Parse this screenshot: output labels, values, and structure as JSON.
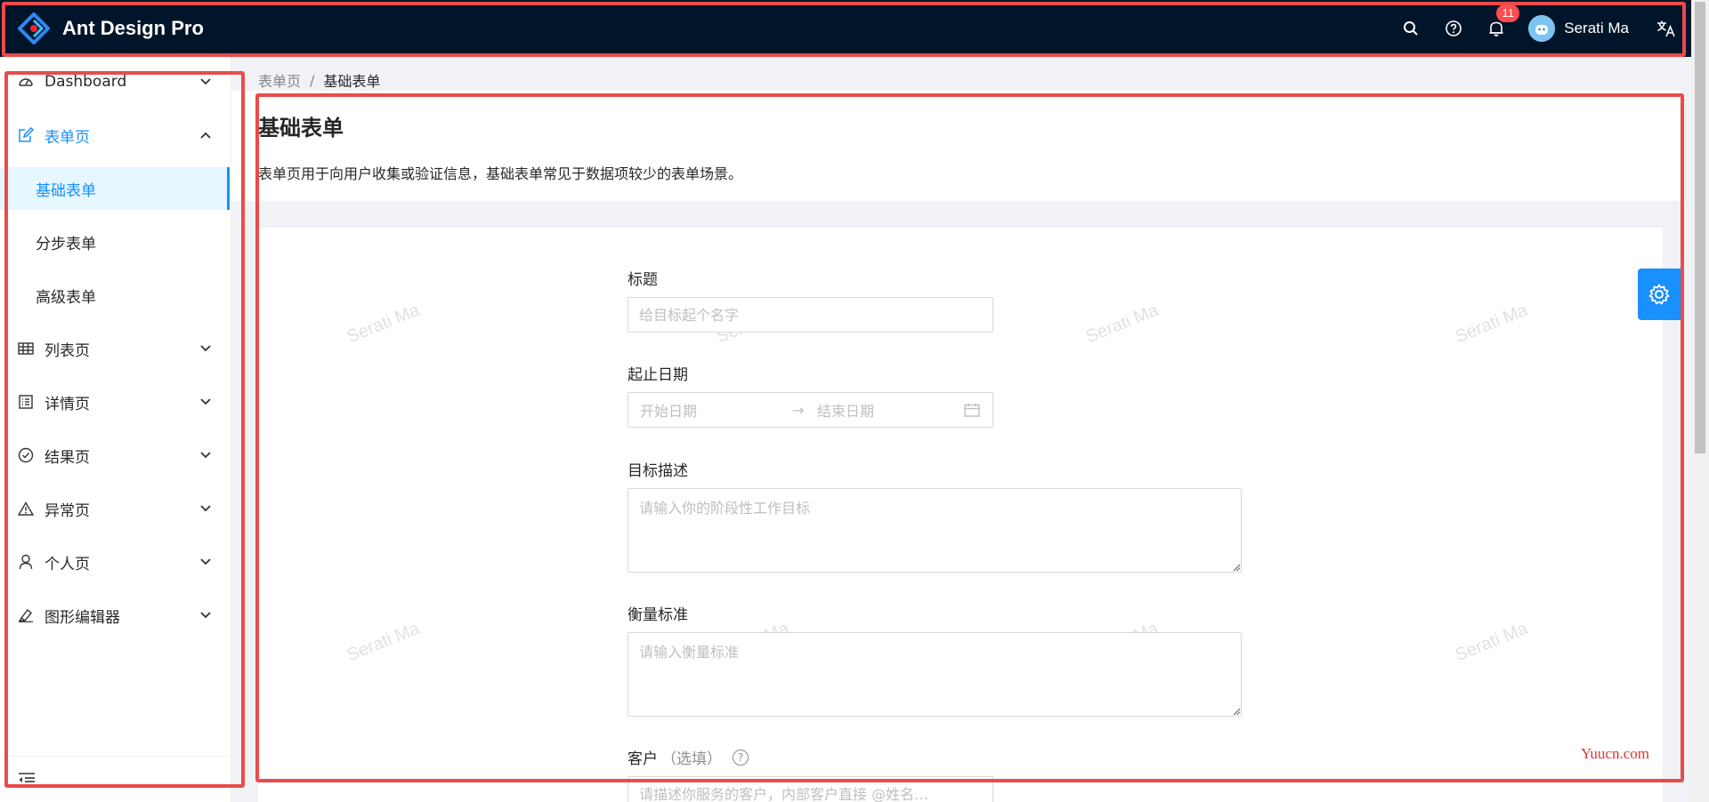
{
  "header": {
    "app_title": "Ant Design Pro",
    "notification_count": "11",
    "user_name": "Serati Ma",
    "icons": [
      "search-icon",
      "question-circle-icon",
      "bell-icon",
      "translation-icon"
    ]
  },
  "sidebar": {
    "items": [
      {
        "label": "Dashboard",
        "icon": "dashboard-icon"
      },
      {
        "label": "表单页",
        "icon": "form-icon",
        "open": true,
        "children": [
          {
            "label": "基础表单",
            "selected": true
          },
          {
            "label": "分步表单"
          },
          {
            "label": "高级表单"
          }
        ]
      },
      {
        "label": "列表页",
        "icon": "table-icon"
      },
      {
        "label": "详情页",
        "icon": "profile-icon"
      },
      {
        "label": "结果页",
        "icon": "check-circle-icon"
      },
      {
        "label": "异常页",
        "icon": "warning-icon"
      },
      {
        "label": "个人页",
        "icon": "user-icon"
      },
      {
        "label": "图形编辑器",
        "icon": "highlight-icon"
      }
    ]
  },
  "breadcrumb": {
    "items": [
      "表单页",
      "基础表单"
    ],
    "separator": "/"
  },
  "page": {
    "title": "基础表单",
    "description": "表单页用于向用户收集或验证信息，基础表单常见于数据项较少的表单场景。"
  },
  "form": {
    "title": {
      "label": "标题",
      "placeholder": "给目标起个名字"
    },
    "date": {
      "label": "起止日期",
      "start_placeholder": "开始日期",
      "end_placeholder": "结束日期",
      "arrow": "→"
    },
    "goal": {
      "label": "目标描述",
      "placeholder": "请输入你的阶段性工作目标"
    },
    "standard": {
      "label": "衡量标准",
      "placeholder": "请输入衡量标准"
    },
    "client": {
      "label": "客户",
      "optional": "（选填）",
      "help": "?",
      "placeholder": "请描述你服务的客户，内部客户直接 @姓名…"
    }
  },
  "watermark": {
    "text": "Serati Ma"
  },
  "site_mark": {
    "text": "Yuucn.com"
  },
  "colors": {
    "header_bg": "#001529",
    "primary": "#1890ff",
    "highlight_box": "#ea4b4b",
    "badge": "#ff4d4f"
  }
}
